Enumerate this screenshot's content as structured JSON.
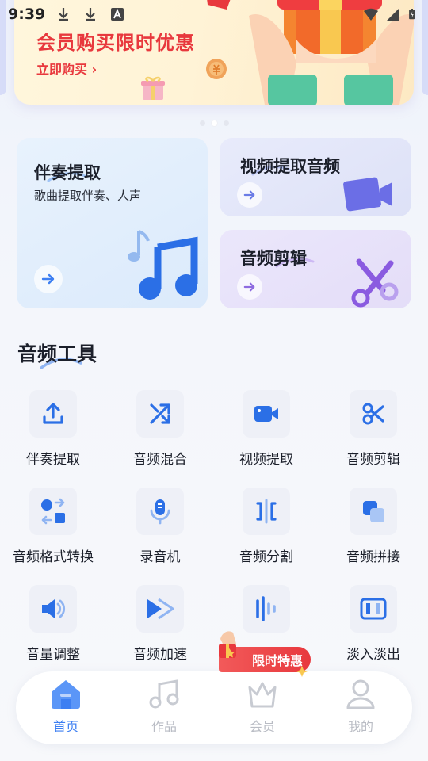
{
  "status_bar": {
    "time": "9:39"
  },
  "banner": {
    "title": "会员购买限时优惠",
    "cta": "立即购买"
  },
  "feature_cards": [
    {
      "id": "accomp",
      "title": "伴奏提取",
      "subtitle": "歌曲提取伴奏、人声"
    },
    {
      "id": "video",
      "title": "视频提取音频"
    },
    {
      "id": "edit",
      "title": "音频剪辑"
    }
  ],
  "section": {
    "title": "音频工具"
  },
  "tools": [
    {
      "label": "伴奏提取",
      "icon": "upload-icon"
    },
    {
      "label": "音频混合",
      "icon": "shuffle-icon"
    },
    {
      "label": "视频提取",
      "icon": "video-camera-icon"
    },
    {
      "label": "音频剪辑",
      "icon": "scissors-icon"
    },
    {
      "label": "音频格式转换",
      "icon": "format-convert-icon"
    },
    {
      "label": "录音机",
      "icon": "microphone-icon"
    },
    {
      "label": "音频分割",
      "icon": "split-icon"
    },
    {
      "label": "音频拼接",
      "icon": "merge-icon"
    },
    {
      "label": "音量调整",
      "icon": "volume-icon"
    },
    {
      "label": "音频加速",
      "icon": "fast-forward-icon"
    },
    {
      "label": "",
      "icon": "waveform-icon"
    },
    {
      "label": "淡入淡出",
      "icon": "fade-icon"
    }
  ],
  "promo_badge": {
    "label": "限时特惠"
  },
  "bottom_nav": [
    {
      "label": "首页",
      "icon": "home-icon",
      "active": true
    },
    {
      "label": "作品",
      "icon": "music-note-icon",
      "active": false
    },
    {
      "label": "会员",
      "icon": "crown-icon",
      "active": false
    },
    {
      "label": "我的",
      "icon": "profile-icon",
      "active": false
    }
  ],
  "colors": {
    "accent_blue": "#3d7ff2",
    "promo_red": "#e8383d",
    "banner_text": "#e8383d",
    "nav_inactive": "#b9bcc4"
  }
}
